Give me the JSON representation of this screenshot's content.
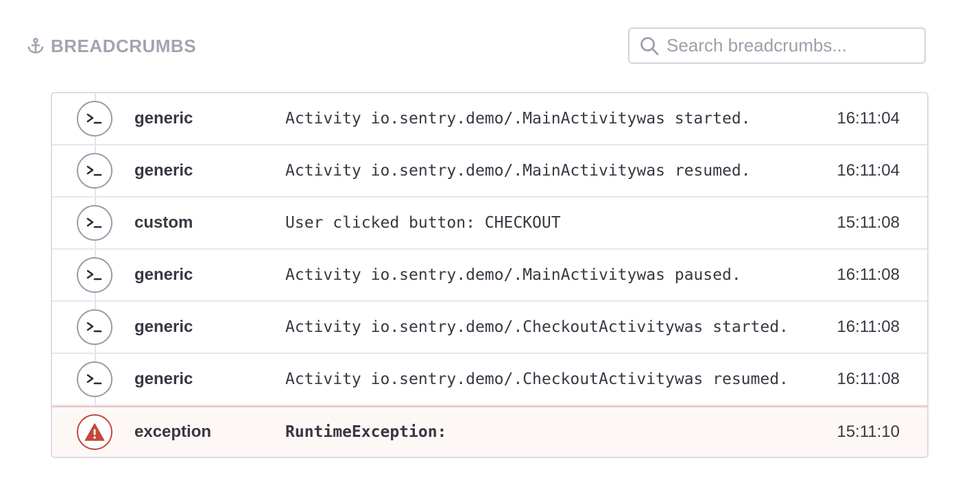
{
  "header": {
    "title": "BREADCRUMBS",
    "icon": "anchor-icon"
  },
  "search": {
    "placeholder": "Search breadcrumbs...",
    "value": "",
    "icon": "search-icon"
  },
  "colors": {
    "muted": "#a7a2b0",
    "border": "#dedbe3",
    "error": "#c4473c",
    "error_bg": "#fdf8f6"
  },
  "breadcrumbs": [
    {
      "type": "generic",
      "message": "Activity io.sentry.demo/.MainActivitywas started.",
      "time": "16:11:04",
      "icon": "terminal-icon",
      "level": "info"
    },
    {
      "type": "generic",
      "message": "Activity io.sentry.demo/.MainActivitywas resumed.",
      "time": "16:11:04",
      "icon": "terminal-icon",
      "level": "info"
    },
    {
      "type": "custom",
      "message": "User clicked button: CHECKOUT",
      "time": "15:11:08",
      "icon": "terminal-icon",
      "level": "info"
    },
    {
      "type": "generic",
      "message": "Activity io.sentry.demo/.MainActivitywas paused.",
      "time": "16:11:08",
      "icon": "terminal-icon",
      "level": "info"
    },
    {
      "type": "generic",
      "message": "Activity io.sentry.demo/.CheckoutActivitywas started.",
      "time": "16:11:08",
      "icon": "terminal-icon",
      "level": "info"
    },
    {
      "type": "generic",
      "message": "Activity io.sentry.demo/.CheckoutActivitywas resumed.",
      "time": "16:11:08",
      "icon": "terminal-icon",
      "level": "info"
    },
    {
      "type": "exception",
      "message": "RuntimeException:",
      "time": "15:11:10",
      "icon": "warning-icon",
      "level": "error"
    }
  ]
}
